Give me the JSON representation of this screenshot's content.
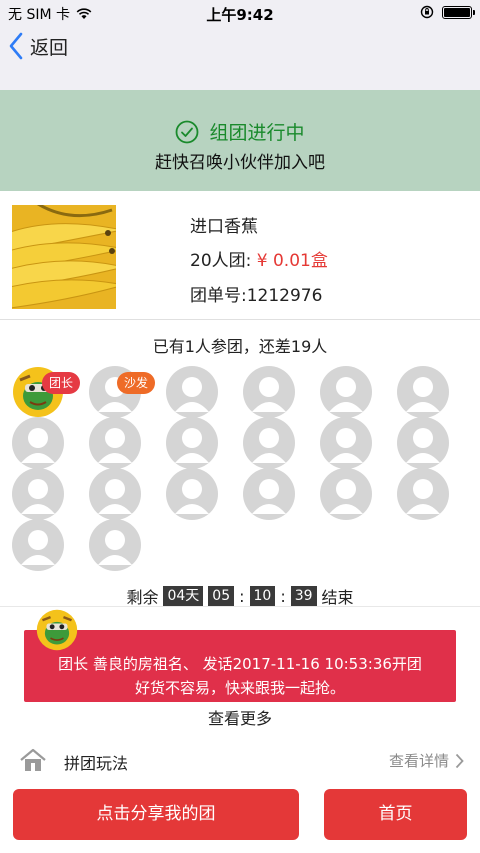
{
  "status_bar": {
    "carrier": "无 SIM 卡",
    "time": "上午9:42"
  },
  "nav": {
    "back_label": "返回"
  },
  "banner": {
    "title": "组团进行中",
    "subtitle": "赶快召唤小伙伴加入吧",
    "accent": "#1a8a2c",
    "background": "#b7d3c0"
  },
  "product": {
    "name": "进口香蕉",
    "group_size_label": "20人团:",
    "price": "¥ 0.01盒",
    "group_id": "团单号:1212976"
  },
  "participants": {
    "summary": "已有1人参团，还差19人",
    "leader_tag": "团长",
    "sofa_tag": "沙发",
    "total_slots": 20,
    "filled": 1
  },
  "countdown": {
    "prefix": "剩余",
    "days": "04天",
    "hours": "05",
    "minutes": "10",
    "seconds": "39",
    "sep": ":",
    "suffix": "结束"
  },
  "message": {
    "line1": "团长 善良的房祖名、 发话2017-11-16 10:53:36开团",
    "line2": "好货不容易，快来跟我一起抢。",
    "background": "#e0304a"
  },
  "see_more": "查看更多",
  "rules": {
    "label": "拼团玩法",
    "detail": "查看详情"
  },
  "buttons": {
    "share": "点击分享我的团",
    "home": "首页",
    "color": "#e43838"
  }
}
